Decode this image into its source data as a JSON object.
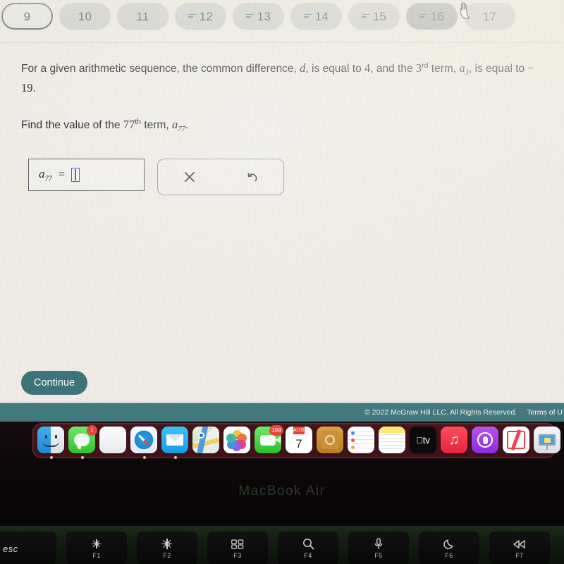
{
  "tabs": [
    {
      "label": "9",
      "partial": false,
      "state": "active"
    },
    {
      "label": "10",
      "partial": false,
      "state": "normal"
    },
    {
      "label": "11",
      "partial": false,
      "state": "normal"
    },
    {
      "label": "12",
      "partial": true,
      "state": "normal"
    },
    {
      "label": "13",
      "partial": true,
      "state": "normal"
    },
    {
      "label": "14",
      "partial": true,
      "state": "normal"
    },
    {
      "label": "15",
      "partial": true,
      "state": "normal"
    },
    {
      "label": "16",
      "partial": true,
      "state": "hovered"
    },
    {
      "label": "17",
      "partial": false,
      "state": "normal"
    }
  ],
  "question": {
    "line1_a": "For a given arithmetic sequence, the common difference, ",
    "line1_var_d": "d",
    "line1_b": ", is equal to ",
    "line1_num4": "4",
    "line1_c": ", and the ",
    "line1_num3": "3",
    "line1_sup_rd": "rd",
    "line1_d": " term, ",
    "line1_var_a": "a",
    "line1_sub_3": "3",
    "line1_e": ", is equal to ",
    "line1_num_neg19": "− 19",
    "line1_f": ".",
    "line2_a": "Find the value of the ",
    "line2_num77": "77",
    "line2_sup_th": "th",
    "line2_b": " term, ",
    "line2_var_a": "a",
    "line2_sub_77": "77",
    "line2_c": "."
  },
  "answer": {
    "variable": "a",
    "subscript": "77",
    "equals": "=",
    "value": "",
    "placeholder": ""
  },
  "tools": {
    "clear_label": "×",
    "undo_label": "↺"
  },
  "actions": {
    "continue_label": "Continue"
  },
  "footer": {
    "copyright": "© 2022 McGraw Hill LLC. All Rights Reserved.",
    "terms": "Terms of U"
  },
  "laptop": {
    "model": "MacBook Air"
  },
  "dock": {
    "items": [
      {
        "name": "finder",
        "badge": ""
      },
      {
        "name": "messages",
        "badge": "1"
      },
      {
        "name": "launchpad",
        "badge": ""
      },
      {
        "name": "safari",
        "badge": ""
      },
      {
        "name": "mail",
        "badge": ""
      },
      {
        "name": "maps",
        "badge": ""
      },
      {
        "name": "photos",
        "badge": ""
      },
      {
        "name": "facetime",
        "badge": "199"
      },
      {
        "name": "calendar",
        "badge": "",
        "month": "AUG",
        "day": "7"
      },
      {
        "name": "contacts",
        "badge": ""
      },
      {
        "name": "reminders",
        "badge": ""
      },
      {
        "name": "notes",
        "badge": ""
      },
      {
        "name": "tv",
        "badge": "",
        "label": "tv"
      },
      {
        "name": "music",
        "badge": ""
      },
      {
        "name": "podcasts",
        "badge": ""
      },
      {
        "name": "news",
        "badge": ""
      },
      {
        "name": "keynote",
        "badge": ""
      }
    ]
  },
  "keyboard": {
    "keys": [
      {
        "label": "esc",
        "fn": ""
      },
      {
        "label": "",
        "fn": "F1"
      },
      {
        "label": "",
        "fn": "F2"
      },
      {
        "label": "",
        "fn": "F3"
      },
      {
        "label": "",
        "fn": "F4"
      },
      {
        "label": "",
        "fn": "F5"
      },
      {
        "label": "",
        "fn": "F6"
      },
      {
        "label": "",
        "fn": "F7"
      }
    ]
  },
  "colors": {
    "page_background": "#f2efe9",
    "accent_teal": "#3d767c",
    "footer_teal": "#447b81",
    "tab_grey": "#c9cdcc",
    "caret_purple": "#5b4ec4"
  }
}
